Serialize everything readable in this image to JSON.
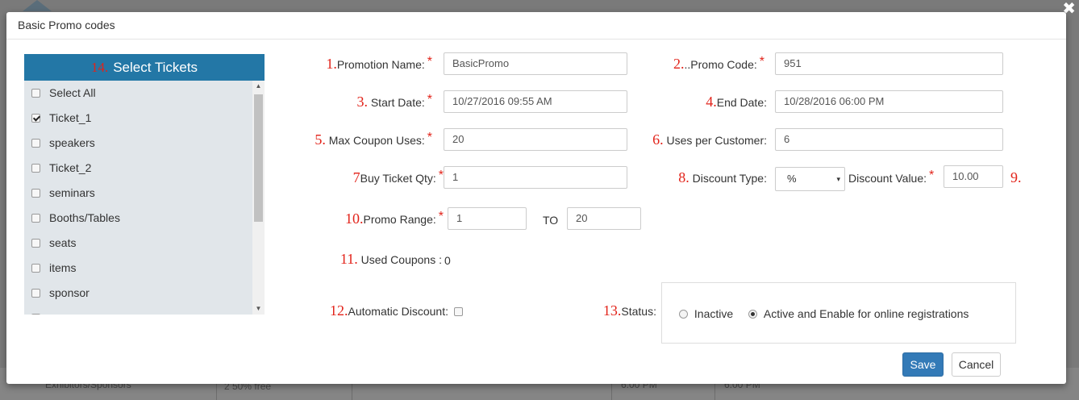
{
  "dialog": {
    "title": "Basic Promo codes",
    "close_glyph": "✖"
  },
  "background": {
    "sidebar_text": "Exhibitors/Sponsors",
    "cell_text_1": "2 50% free",
    "cell_text_2": "6:00 PM",
    "cell_text_3": "6:00 PM"
  },
  "tickets": {
    "number": "14.",
    "header": "Select Tickets",
    "items": [
      {
        "label": "Select All",
        "checked": false
      },
      {
        "label": "Ticket_1",
        "checked": true
      },
      {
        "label": "speakers",
        "checked": false
      },
      {
        "label": "Ticket_2",
        "checked": false
      },
      {
        "label": "seminars",
        "checked": false
      },
      {
        "label": "Booths/Tables",
        "checked": false
      },
      {
        "label": "seats",
        "checked": false
      },
      {
        "label": "items",
        "checked": false
      },
      {
        "label": "sponsor",
        "checked": false
      }
    ]
  },
  "form": {
    "promotion_name": {
      "num": "1.",
      "label": "Promotion Name:",
      "value": "BasicPromo"
    },
    "promo_code": {
      "num": "2.",
      "label": "..Promo Code:",
      "value": "951"
    },
    "start_date": {
      "num": "3.",
      "label": "Start Date:",
      "value": "10/27/2016 09:55 AM"
    },
    "end_date": {
      "num": "4.",
      "label": "End Date:",
      "value": "10/28/2016 06:00 PM"
    },
    "max_coupon_uses": {
      "num": "5.",
      "label": "Max Coupon Uses:",
      "value": "20"
    },
    "uses_per_customer": {
      "num": "6.",
      "label": "Uses per Customer:",
      "value": "6"
    },
    "buy_ticket_qty": {
      "num": "7",
      "label": "Buy Ticket Qty:",
      "value": "1"
    },
    "discount_type": {
      "num": "8.",
      "label": "Discount Type:",
      "value": "%"
    },
    "discount_value": {
      "num": "9.",
      "label": "Discount Value:",
      "value": "10.00"
    },
    "promo_range": {
      "num": "10.",
      "label": "Promo Range:",
      "from": "1",
      "to_label": "TO",
      "to": "20"
    },
    "used_coupons": {
      "num": "11.",
      "label": "Used Coupons :",
      "value": "0"
    },
    "automatic_discount": {
      "num": "12.",
      "label": "Automatic Discount:",
      "checked": false
    },
    "status": {
      "num": "13.",
      "label": "Status:",
      "options": [
        "Inactive",
        "Active and Enable for online registrations"
      ],
      "selected": "Active and Enable for online registrations"
    },
    "required_mark": "*",
    "select_caret": "▾"
  },
  "buttons": {
    "save": "Save",
    "cancel": "Cancel"
  },
  "scrollbar": {
    "up": "▲",
    "down": "▼"
  },
  "colors": {
    "header_blue": "#2377a6",
    "annotation_red": "#e2231a",
    "save_blue": "#337ab7"
  }
}
